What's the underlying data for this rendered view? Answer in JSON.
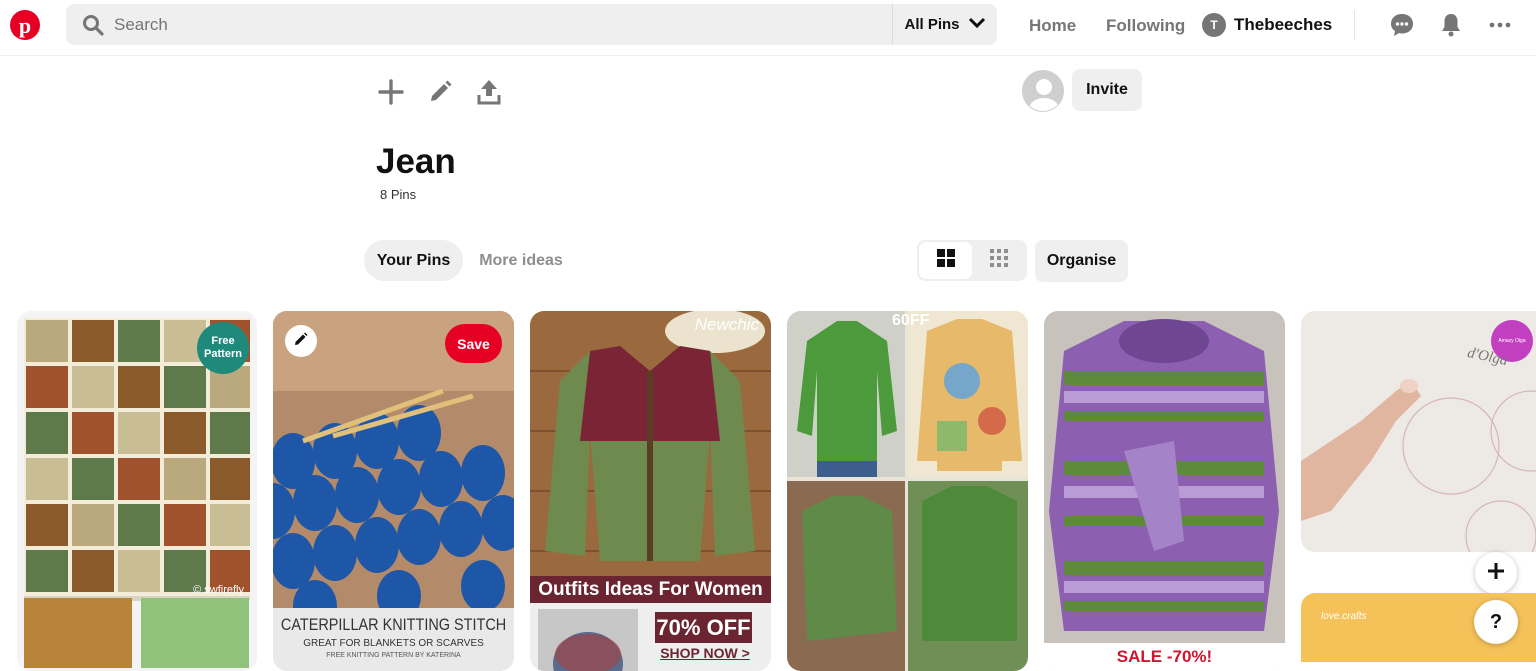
{
  "header": {
    "search_placeholder": "Search",
    "scope_label": "All Pins",
    "nav_home": "Home",
    "nav_following": "Following",
    "user_initial": "T",
    "user_name": "Thebeeches"
  },
  "board": {
    "title": "Jean",
    "pin_count": "8 Pins",
    "invite_label": "Invite",
    "organise_label": "Organise",
    "tabs": [
      "Your Pins",
      "More ideas"
    ]
  },
  "pins": [
    {
      "badge_line1": "Free",
      "badge_line2": "Pattern",
      "watermark": "© swfirefly"
    },
    {
      "save_label": "Save",
      "caption_title": "CATERPILLAR KNITTING STITCH",
      "caption_sub": "GREAT FOR BLANKETS OR SCARVES",
      "caption_small": "FREE KNITTING PATTERN BY KATERINA"
    },
    {
      "brand": "Newchic",
      "banner": "Outfits Ideas For Women",
      "promo": "70% OFF",
      "cta": "SHOP NOW >"
    },
    {
      "badge": "60FF"
    },
    {
      "sale": "SALE -70%!"
    },
    {
      "brand": "Amazy Olga",
      "watermark": "d'Olga",
      "next_label": "love.crafts"
    }
  ],
  "help_label": "?",
  "colors": {
    "brand": "#e60023",
    "grey_btn": "#efefef",
    "muted": "#767676"
  }
}
